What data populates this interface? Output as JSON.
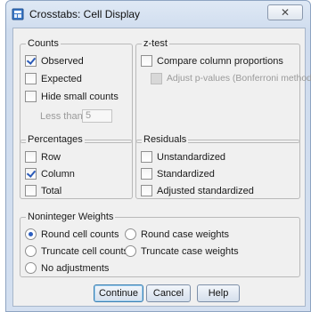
{
  "window": {
    "title": "Crosstabs: Cell Display",
    "close_symbol": "✕"
  },
  "counts": {
    "legend": "Counts",
    "observed": {
      "label": "Observed",
      "checked": true
    },
    "expected": {
      "label": "Expected",
      "checked": false
    },
    "hide_small": {
      "label": "Hide small counts",
      "checked": false
    },
    "less_than_label": "Less than",
    "less_than_value": "5"
  },
  "ztest": {
    "legend": "z-test",
    "compare": {
      "label": "Compare column proportions",
      "checked": false
    },
    "adjust": {
      "label": "Adjust p-values (Bonferroni method)",
      "checked": false,
      "enabled": false
    }
  },
  "percentages": {
    "legend": "Percentages",
    "row": {
      "label": "Row",
      "checked": false
    },
    "column": {
      "label": "Column",
      "checked": true
    },
    "total": {
      "label": "Total",
      "checked": false
    }
  },
  "residuals": {
    "legend": "Residuals",
    "unstandardized": {
      "label": "Unstandardized",
      "checked": false
    },
    "standardized": {
      "label": "Standardized",
      "checked": false
    },
    "adjusted": {
      "label": "Adjusted standardized",
      "checked": false
    }
  },
  "weights": {
    "legend": "Noninteger Weights",
    "round_cell": {
      "label": "Round cell counts",
      "selected": true
    },
    "round_case": {
      "label": "Round case weights",
      "selected": false
    },
    "truncate_cell": {
      "label": "Truncate cell counts",
      "selected": false
    },
    "truncate_case": {
      "label": "Truncate case weights",
      "selected": false
    },
    "no_adjust": {
      "label": "No adjustments",
      "selected": false
    }
  },
  "buttons": {
    "continue": "Continue",
    "cancel": "Cancel",
    "help": "Help"
  }
}
